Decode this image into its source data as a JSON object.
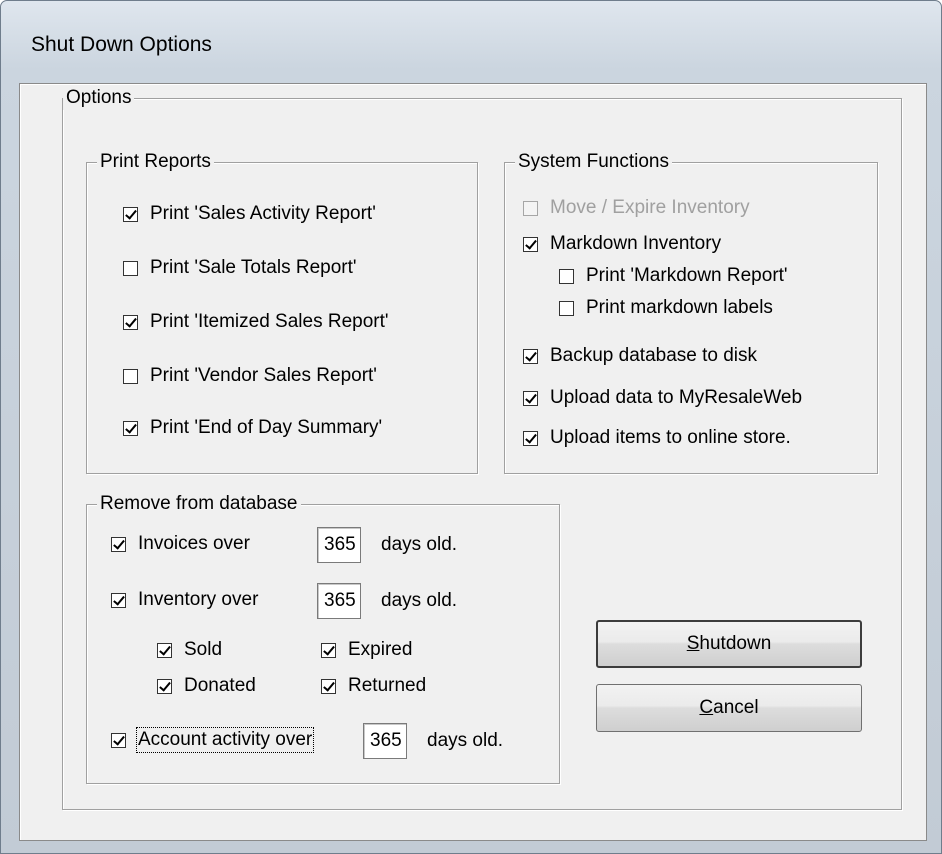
{
  "window": {
    "title": "Shut Down Options"
  },
  "options_group": {
    "label": "Options"
  },
  "print_reports": {
    "label": "Print Reports",
    "items": [
      {
        "label": "Print 'Sales Activity Report'",
        "checked": true
      },
      {
        "label": "Print 'Sale Totals Report'",
        "checked": false
      },
      {
        "label": "Print 'Itemized Sales Report'",
        "checked": true
      },
      {
        "label": "Print 'Vendor Sales Report'",
        "checked": false
      },
      {
        "label": "Print 'End of Day Summary'",
        "checked": true
      }
    ]
  },
  "system_functions": {
    "label": "System Functions",
    "move_expire": {
      "label": "Move / Expire Inventory",
      "checked": false,
      "enabled": false
    },
    "markdown_inventory": {
      "label": "Markdown Inventory",
      "checked": true
    },
    "print_markdown_report": {
      "label": "Print 'Markdown Report'",
      "checked": false
    },
    "print_markdown_labels": {
      "label": "Print markdown labels",
      "checked": false
    },
    "backup_database": {
      "label": "Backup database to disk",
      "checked": true
    },
    "upload_data": {
      "label": "Upload data to MyResaleWeb",
      "checked": true
    },
    "upload_items": {
      "label": "Upload items to online store.",
      "checked": true
    }
  },
  "remove_from_database": {
    "label": "Remove from database",
    "invoices": {
      "label": "Invoices over",
      "checked": true,
      "days": "365",
      "suffix": "days old."
    },
    "inventory": {
      "label": "Inventory over",
      "checked": true,
      "days": "365",
      "suffix": "days old."
    },
    "sold": {
      "label": "Sold",
      "checked": true
    },
    "expired": {
      "label": "Expired",
      "checked": true
    },
    "donated": {
      "label": "Donated",
      "checked": true
    },
    "returned": {
      "label": "Returned",
      "checked": true
    },
    "account_activity": {
      "label": "Account activity over",
      "checked": true,
      "days": "365",
      "suffix": "days old."
    }
  },
  "buttons": {
    "shutdown": {
      "accel": "S",
      "rest": "hutdown"
    },
    "cancel": {
      "accel": "C",
      "rest": "ancel"
    }
  }
}
